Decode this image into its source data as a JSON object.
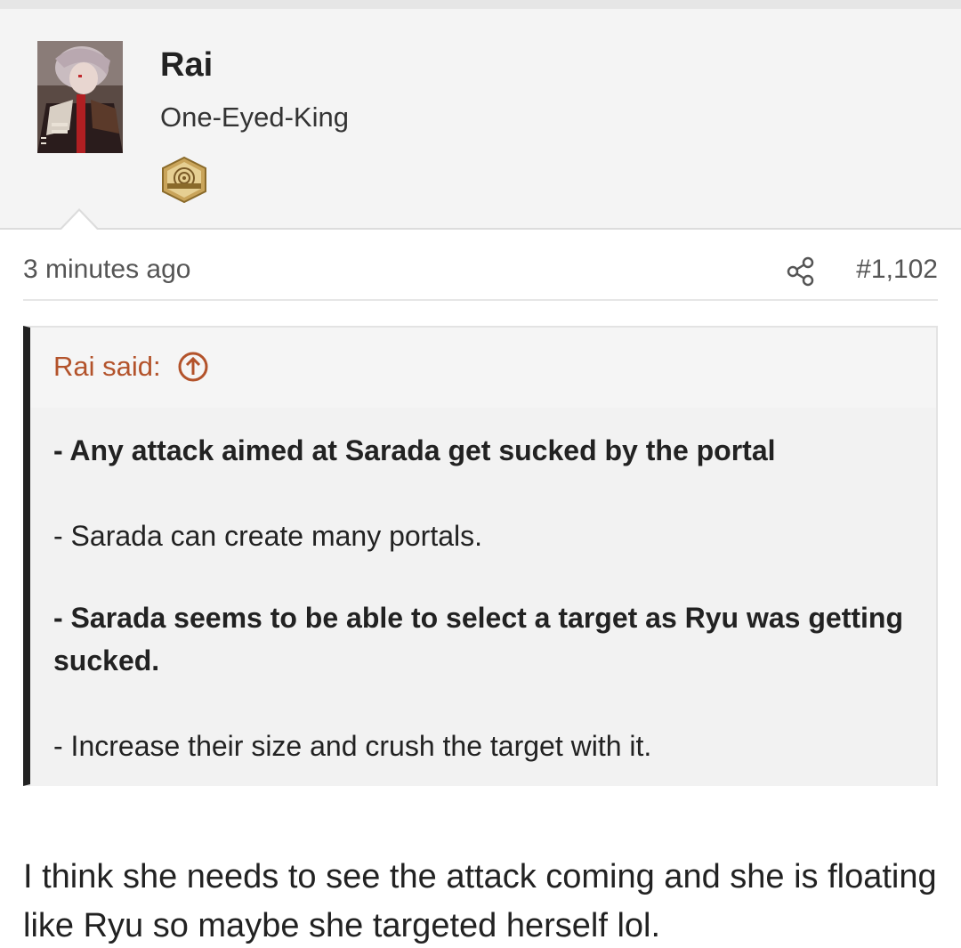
{
  "user": {
    "name": "Rai",
    "title": "One-Eyed-King",
    "badge_icon": "fanverse-badge-icon",
    "avatar_icon": "avatar-image"
  },
  "post": {
    "timestamp": "3 minutes ago",
    "share_icon": "share-icon",
    "number": "#1,102"
  },
  "quote": {
    "attribution": "Rai said:",
    "jump_icon": "arrow-up-circle-icon",
    "lines": [
      "- Any attack aimed at Sarada get sucked by the portal",
      "- Sarada can create many portals.",
      "- Sarada seems to be able to select a target as Ryu was getting sucked.",
      "- Increase their size and crush the target with it."
    ]
  },
  "reply": {
    "text": "I think she needs to see the attack coming and she is floating like Ryu so maybe she targeted herself lol."
  },
  "colors": {
    "quote_accent": "#b3532b",
    "quote_border": "#222222",
    "header_bg": "#f4f4f4"
  }
}
